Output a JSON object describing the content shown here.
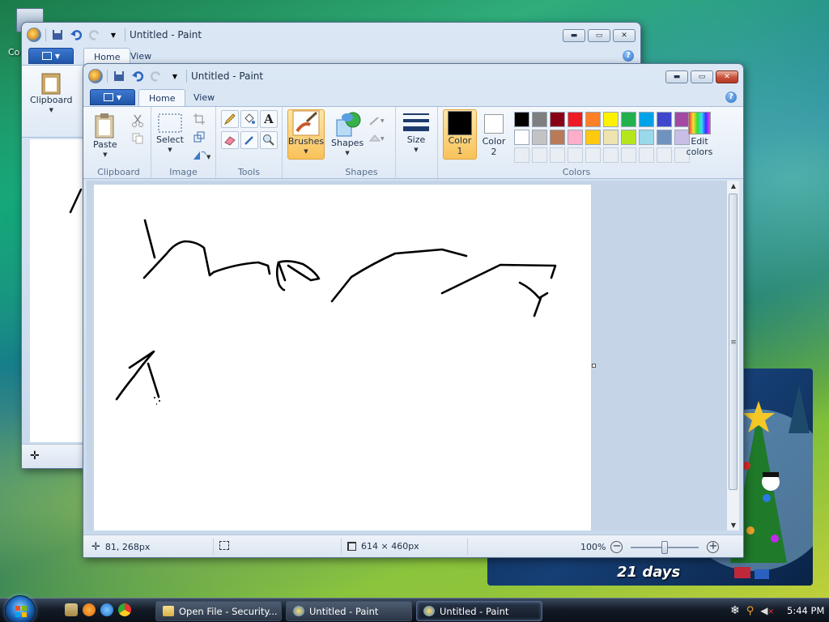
{
  "desktop": {
    "icon_label": "Co"
  },
  "back_window": {
    "title": "Untitled - Paint",
    "tabs": [
      "Home",
      "View"
    ],
    "clipboard_group": "Clipboard",
    "paste_label": "Paste"
  },
  "window": {
    "title": "Untitled - Paint",
    "tabs": {
      "home": "Home",
      "view": "View"
    },
    "groups": {
      "clipboard": "Clipboard",
      "image": "Image",
      "tools": "Tools",
      "shapes": "Shapes",
      "colors": "Colors"
    },
    "buttons": {
      "paste": "Paste",
      "select": "Select",
      "brushes": "Brushes",
      "shapes": "Shapes",
      "size": "Size",
      "color1_line1": "Color",
      "color1_line2": "1",
      "color2_line1": "Color",
      "color2_line2": "2",
      "edit_colors_line1": "Edit",
      "edit_colors_line2": "colors"
    },
    "palette_row1": [
      "#000000",
      "#7f7f7f",
      "#880015",
      "#ed1c24",
      "#ff7f27",
      "#fff200",
      "#22b14c",
      "#00a2e8",
      "#3f48cc",
      "#a349a4"
    ],
    "palette_row2": [
      "#ffffff",
      "#c3c3c3",
      "#b97a57",
      "#ffaec9",
      "#ffc90e",
      "#efe4b0",
      "#b5e61d",
      "#99d9ea",
      "#7092be",
      "#c8bfe7"
    ],
    "color1": "#000000",
    "color2": "#ffffff",
    "status": {
      "cursor_pos": "81, 268px",
      "canvas_size": "614 × 460px",
      "zoom": "100%"
    }
  },
  "gadget": {
    "days_text": "21 days"
  },
  "taskbar": {
    "items": [
      {
        "label": "Open File - Security...",
        "active": false
      },
      {
        "label": "Untitled - Paint",
        "active": false
      },
      {
        "label": "Untitled - Paint",
        "active": true
      }
    ],
    "clock": "5:44 PM"
  }
}
